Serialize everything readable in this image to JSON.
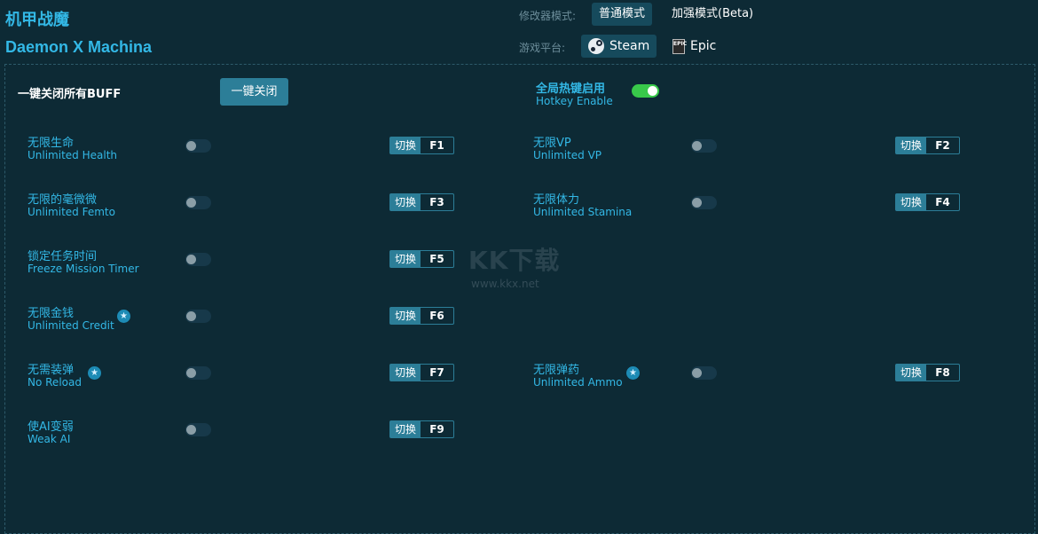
{
  "header": {
    "title_cn": "机甲战魔",
    "title_en": "Daemon X Machina",
    "mode_label": "修改器模式:",
    "mode_normal": "普通模式",
    "mode_enhanced": "加强模式(Beta)",
    "platform_label": "游戏平台:",
    "platform_steam": "Steam",
    "platform_epic": "Epic",
    "epic_icon_text": "EPIC"
  },
  "controls": {
    "all_buff_label": "一键关闭所有BUFF",
    "close_all_button": "一键关闭",
    "hotkey_cn": "全局热键启用",
    "hotkey_en": "Hotkey Enable",
    "hotkey_enabled": true
  },
  "switch_label": "切换",
  "star_glyph": "★",
  "cheats": [
    {
      "cn": "无限生命",
      "en": "Unlimited Health",
      "key": "F1",
      "star": false
    },
    {
      "cn": "无限VP",
      "en": "Unlimited VP",
      "key": "F2",
      "star": false
    },
    {
      "cn": "无限的毫微微",
      "en": "Unlimited Femto",
      "key": "F3",
      "star": false
    },
    {
      "cn": "无限体力",
      "en": "Unlimited Stamina",
      "key": "F4",
      "star": false
    },
    {
      "cn": "锁定任务时间",
      "en": "Freeze Mission Timer",
      "key": "F5",
      "star": false
    },
    {
      "cn": "无限金钱",
      "en": "Unlimited Credit",
      "key": "F6",
      "star": true
    },
    {
      "cn": "无需装弹",
      "en": "No Reload",
      "key": "F7",
      "star": true
    },
    {
      "cn": "无限弹药",
      "en": "Unlimited Ammo",
      "key": "F8",
      "star": true
    },
    {
      "cn": "使AI变弱",
      "en": "Weak AI",
      "key": "F9",
      "star": false
    }
  ],
  "watermark": {
    "logo": "KK下载",
    "url": "www.kkx.net"
  },
  "colors": {
    "background": "#0d2a35",
    "accent": "#33b8e6",
    "button": "#2c7e98",
    "toggle_on": "#38c94a"
  }
}
